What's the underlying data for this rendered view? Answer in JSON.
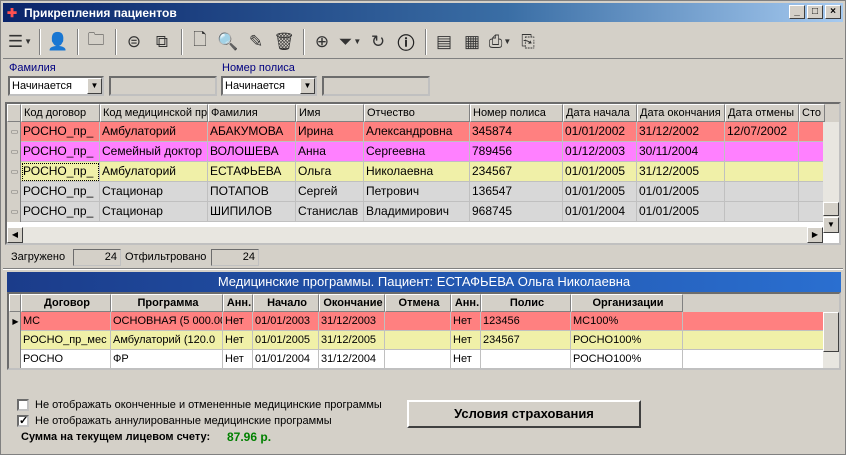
{
  "window": {
    "title": "Прикрепления пациентов",
    "controls": [
      "_",
      "□",
      "×"
    ]
  },
  "toolbar": {
    "icons": [
      "list-menu-icon",
      "patient-search-icon",
      "folder-icon",
      "circle-list-icon",
      "copy-icon",
      "new-document-icon",
      "find-icon",
      "edit-pen-icon",
      "trash-icon",
      "binoculars-icon",
      "filter-icon",
      "refresh-icon",
      "info-icon",
      "report-icon",
      "report-edit-icon",
      "print-icon",
      "export-icon"
    ]
  },
  "filters": {
    "surname": {
      "label": "Фамилия",
      "mode": "Начинается",
      "value": ""
    },
    "policy": {
      "label": "Номер полиса",
      "mode": "Начинается",
      "value": ""
    }
  },
  "patients": {
    "columns": [
      "Код договор",
      "Код медицинской пр",
      "Фамилия",
      "Имя",
      "Отчество",
      "Номер полиса",
      "Дата начала",
      "Дата окончания",
      "Дата отмены",
      "Сто"
    ],
    "rows": [
      {
        "color": "#ff8080",
        "cells": [
          "РОСНО_пр_",
          "Амбулаторий",
          "АБАКУМОВА",
          "Ирина",
          "Александровна",
          "345874",
          "01/01/2002",
          "31/12/2002",
          "12/07/2002",
          ""
        ]
      },
      {
        "color": "#ff80ff",
        "cells": [
          "РОСНО_пр_",
          "Семейный доктор",
          "ВОЛОШЕВА",
          "Анна",
          "Сергеевна",
          "789456",
          "01/12/2003",
          "30/11/2004",
          "",
          ""
        ]
      },
      {
        "color": "#f0f0a8",
        "cells": [
          "РОСНО_пр_",
          "Амбулаторий",
          "ЕСТАФЬЕВА",
          "Ольга",
          "Николаевна",
          "234567",
          "01/01/2005",
          "31/12/2005",
          "",
          ""
        ]
      },
      {
        "color": "#d8d8d8",
        "cells": [
          "РОСНО_пр_",
          "Стационар",
          "ПОТАПОВ",
          "Сергей",
          "Петрович",
          "136547",
          "01/01/2005",
          "01/01/2005",
          "",
          ""
        ]
      },
      {
        "color": "#d8d8d8",
        "cells": [
          "РОСНО_пр_",
          "Стационар",
          "ШИПИЛОВ",
          "Станислав",
          "Владимирович",
          "968745",
          "01/01/2004",
          "01/01/2005",
          "",
          ""
        ]
      }
    ]
  },
  "status": {
    "loaded_label": "Загружено",
    "loaded_value": "24",
    "filtered_label": "Отфильтровано",
    "filtered_value": "24"
  },
  "programs": {
    "title": "Медицинские программы. Пациент: ЕСТАФЬЕВА Ольга Николаевна",
    "columns": [
      "Договор",
      "Программа",
      "Анн.",
      "Начало",
      "Окончание",
      "Отмена",
      "Анн.",
      "Полис",
      "Организации"
    ],
    "rows": [
      {
        "color": "#ff8080",
        "cells": [
          "МС",
          "ОСНОВНАЯ (5 000.00",
          "Нет",
          "01/01/2003",
          "31/12/2003",
          "",
          "Нет",
          "123456",
          "МС100%"
        ]
      },
      {
        "color": "#f0f0a8",
        "cells": [
          "РОСНО_пр_мес",
          "Амбулаторий (120.0",
          "Нет",
          "01/01/2005",
          "31/12/2005",
          "",
          "Нет",
          "234567",
          "РОСНО100%"
        ]
      },
      {
        "color": "#ffffff",
        "cells": [
          "РОСНО",
          "ФР",
          "Нет",
          "01/01/2004",
          "31/12/2004",
          "",
          "Нет",
          "",
          "РОСНО100%"
        ]
      }
    ]
  },
  "options": {
    "hide_finished": {
      "label": "Не отображать оконченные и отмененные медицинские программы",
      "checked": false
    },
    "hide_annulled": {
      "label": "Не отображать аннулированные медицинские программы",
      "checked": true
    }
  },
  "insurance_button": "Условия страхования",
  "balance": {
    "label": "Сумма на текущем лицевом счету:",
    "value": "87.96 р."
  }
}
